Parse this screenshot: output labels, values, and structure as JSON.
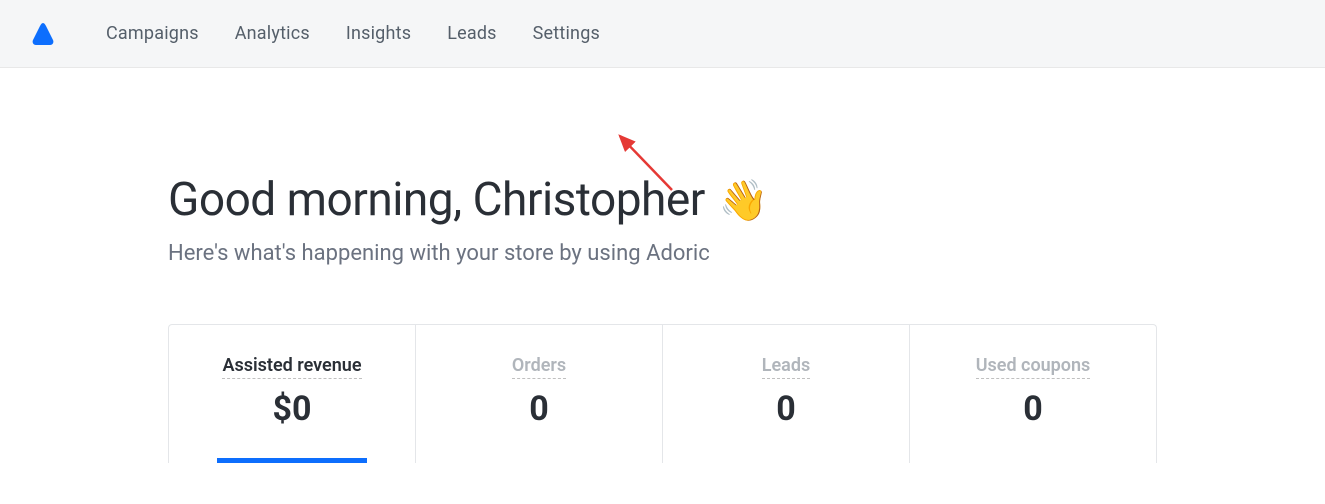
{
  "nav": {
    "items": [
      {
        "label": "Campaigns"
      },
      {
        "label": "Analytics"
      },
      {
        "label": "Insights"
      },
      {
        "label": "Leads"
      },
      {
        "label": "Settings"
      }
    ]
  },
  "header": {
    "greeting": "Good morning, Christopher",
    "wave_emoji": "👋",
    "subtitle": "Here's what's happening with your store by using Adoric"
  },
  "stats": [
    {
      "label": "Assisted revenue",
      "value": "$0",
      "active": true
    },
    {
      "label": "Orders",
      "value": "0",
      "active": false
    },
    {
      "label": "Leads",
      "value": "0",
      "active": false
    },
    {
      "label": "Used coupons",
      "value": "0",
      "active": false
    }
  ],
  "colors": {
    "brand_blue": "#0d6efd",
    "arrow_red": "#e53935"
  }
}
